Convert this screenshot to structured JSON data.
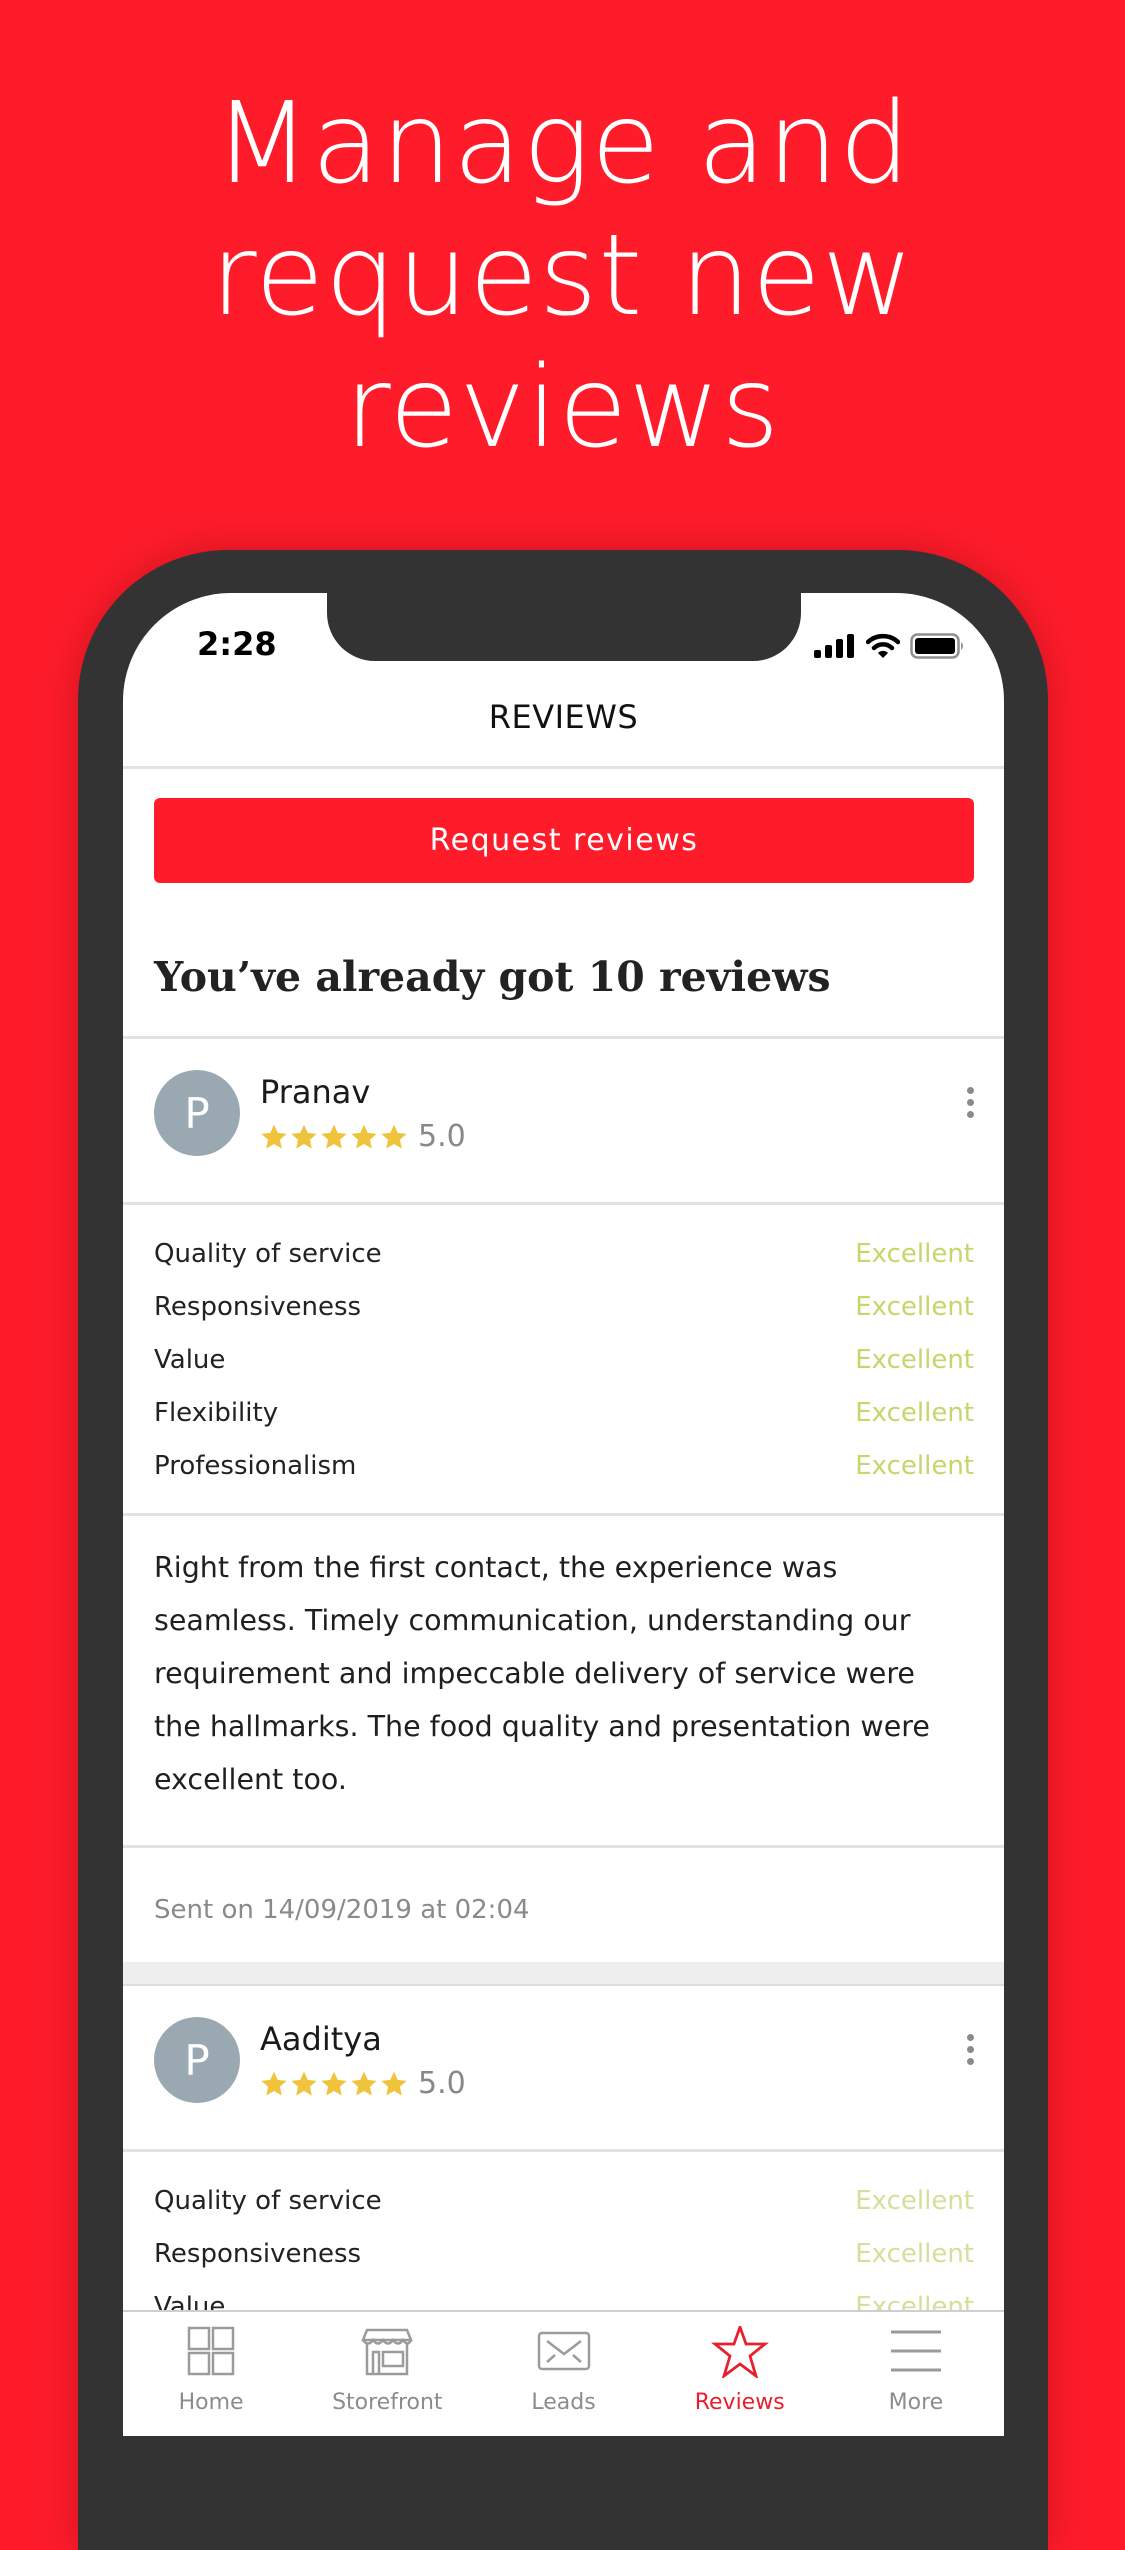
{
  "promo": {
    "headline_lines": [
      "Manage and",
      "request new",
      "reviews"
    ]
  },
  "status_bar": {
    "time": "2:28",
    "icons": [
      "cellular-signal-icon",
      "wifi-icon",
      "battery-icon"
    ]
  },
  "nav": {
    "title": "REVIEWS"
  },
  "actions": {
    "request_label": "Request reviews"
  },
  "summary": {
    "heading": "You’ve already got 10 reviews"
  },
  "colors": {
    "brand_red": "#fe1c2b",
    "star_gold": "#f0c33c",
    "excellent_green": "#c5d66a",
    "avatar_grey": "#9aa9b1"
  },
  "reviews": [
    {
      "avatar_initial": "P",
      "name": "Pranav",
      "stars": 5,
      "rating": "5.0",
      "criteria": [
        {
          "label": "Quality of service",
          "value": "Excellent"
        },
        {
          "label": "Responsiveness",
          "value": "Excellent"
        },
        {
          "label": "Value",
          "value": "Excellent"
        },
        {
          "label": "Flexibility",
          "value": "Excellent"
        },
        {
          "label": "Professionalism",
          "value": "Excellent"
        }
      ],
      "text_lines": [
        "Right from the first contact, the experience was",
        "seamless. Timely communication, understanding our",
        "requirement and impeccable delivery of service were",
        "the hallmarks. The food quality and presentation were",
        "excellent too."
      ],
      "sent_on": "Sent on 14/09/2019 at 02:04"
    },
    {
      "avatar_initial": "P",
      "name": "Aaditya",
      "stars": 5,
      "rating": "5.0",
      "criteria": [
        {
          "label": "Quality of service",
          "value": "Excellent"
        },
        {
          "label": "Responsiveness",
          "value": "Excellent"
        },
        {
          "label": "Value",
          "value": "Excellent"
        }
      ]
    }
  ],
  "tabbar": {
    "items": [
      {
        "label": "Home",
        "icon": "home-grid-icon",
        "active": false
      },
      {
        "label": "Storefront",
        "icon": "storefront-icon",
        "active": false
      },
      {
        "label": "Leads",
        "icon": "envelope-icon",
        "active": false
      },
      {
        "label": "Reviews",
        "icon": "star-icon",
        "active": true
      },
      {
        "label": "More",
        "icon": "hamburger-menu-icon",
        "active": false
      }
    ]
  }
}
